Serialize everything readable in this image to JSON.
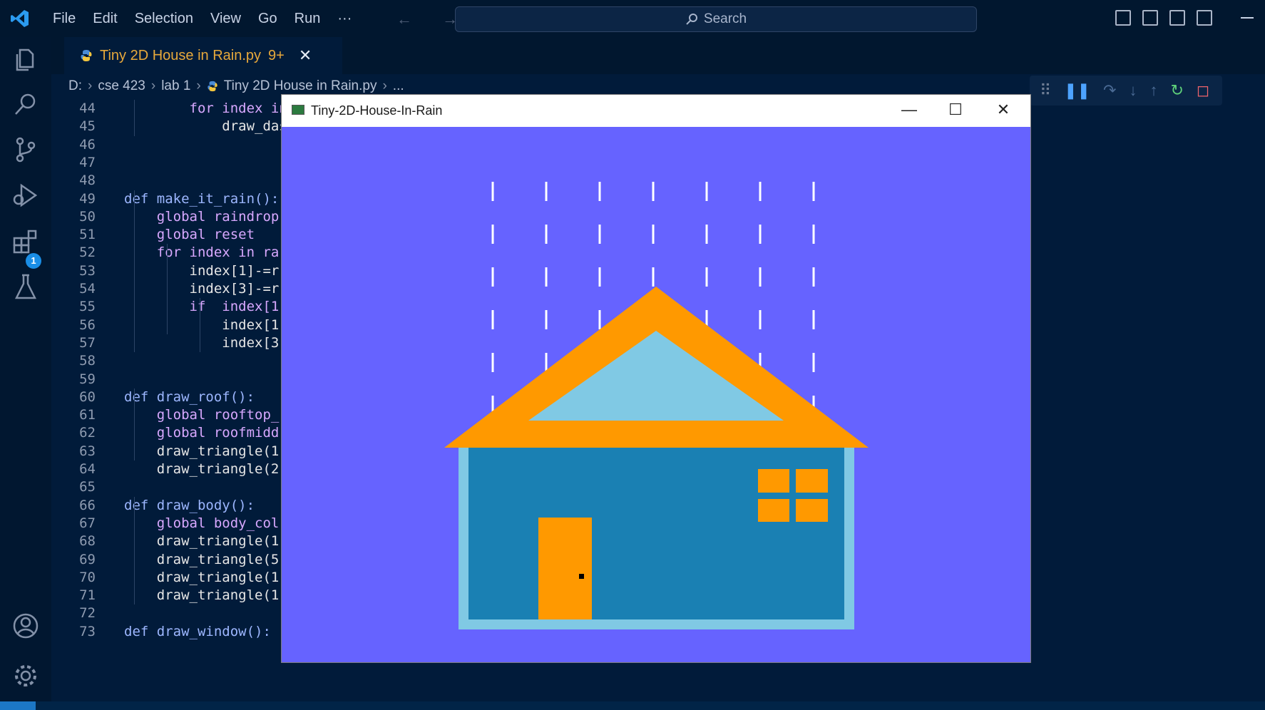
{
  "menu": [
    "File",
    "Edit",
    "Selection",
    "View",
    "Go",
    "Run",
    "···"
  ],
  "nav_arrows": "←  →",
  "search": {
    "label": "Search"
  },
  "tab": {
    "title": "Tiny 2D House in Rain.py",
    "problems": "9+",
    "close": "✕"
  },
  "breadcrumb": [
    "D:",
    "cse 423",
    "lab 1",
    "Tiny 2D House in Rain.py",
    "..."
  ],
  "debug_badge": "1",
  "code_lines": [
    {
      "n": "44",
      "text": "        for index in ra"
    },
    {
      "n": "45",
      "text": "            draw_dashed"
    },
    {
      "n": "46",
      "text": ""
    },
    {
      "n": "47",
      "text": ""
    },
    {
      "n": "48",
      "text": ""
    },
    {
      "n": "49",
      "text": "def make_it_rain():"
    },
    {
      "n": "50",
      "text": "    global raindrop"
    },
    {
      "n": "51",
      "text": "    global reset"
    },
    {
      "n": "52",
      "text": "    for index in ra"
    },
    {
      "n": "53",
      "text": "        index[1]-=r"
    },
    {
      "n": "54",
      "text": "        index[3]-=r"
    },
    {
      "n": "55",
      "text": "        if  index[1"
    },
    {
      "n": "56",
      "text": "            index[1"
    },
    {
      "n": "57",
      "text": "            index[3"
    },
    {
      "n": "58",
      "text": ""
    },
    {
      "n": "59",
      "text": ""
    },
    {
      "n": "60",
      "text": "def draw_roof():"
    },
    {
      "n": "61",
      "text": "    global rooftop_"
    },
    {
      "n": "62",
      "text": "    global roofmidd"
    },
    {
      "n": "63",
      "text": "    draw_triangle(1"
    },
    {
      "n": "64",
      "text": "    draw_triangle(2"
    },
    {
      "n": "65",
      "text": ""
    },
    {
      "n": "66",
      "text": "def draw_body():"
    },
    {
      "n": "67",
      "text": "    global body_col"
    },
    {
      "n": "68",
      "text": "    draw_triangle(1"
    },
    {
      "n": "69",
      "text": "    draw_triangle(5"
    },
    {
      "n": "70",
      "text": "    draw_triangle(1"
    },
    {
      "n": "71",
      "text": "    draw_triangle(1"
    },
    {
      "n": "72",
      "text": ""
    },
    {
      "n": "73",
      "text": "def draw_window():"
    }
  ],
  "app_window": {
    "title": "Tiny-2D-House-In-Rain",
    "minimize": "—",
    "maximize": "☐",
    "close": "✕"
  },
  "colors": {
    "sky": "#6663ff",
    "roof": "#ff9900",
    "roof_inner": "#80c9e4",
    "wall_border": "#80c9e4",
    "wall": "#1a80b3",
    "door": "#ff9900",
    "window": "#ff9900",
    "rain": "#ffffff"
  }
}
